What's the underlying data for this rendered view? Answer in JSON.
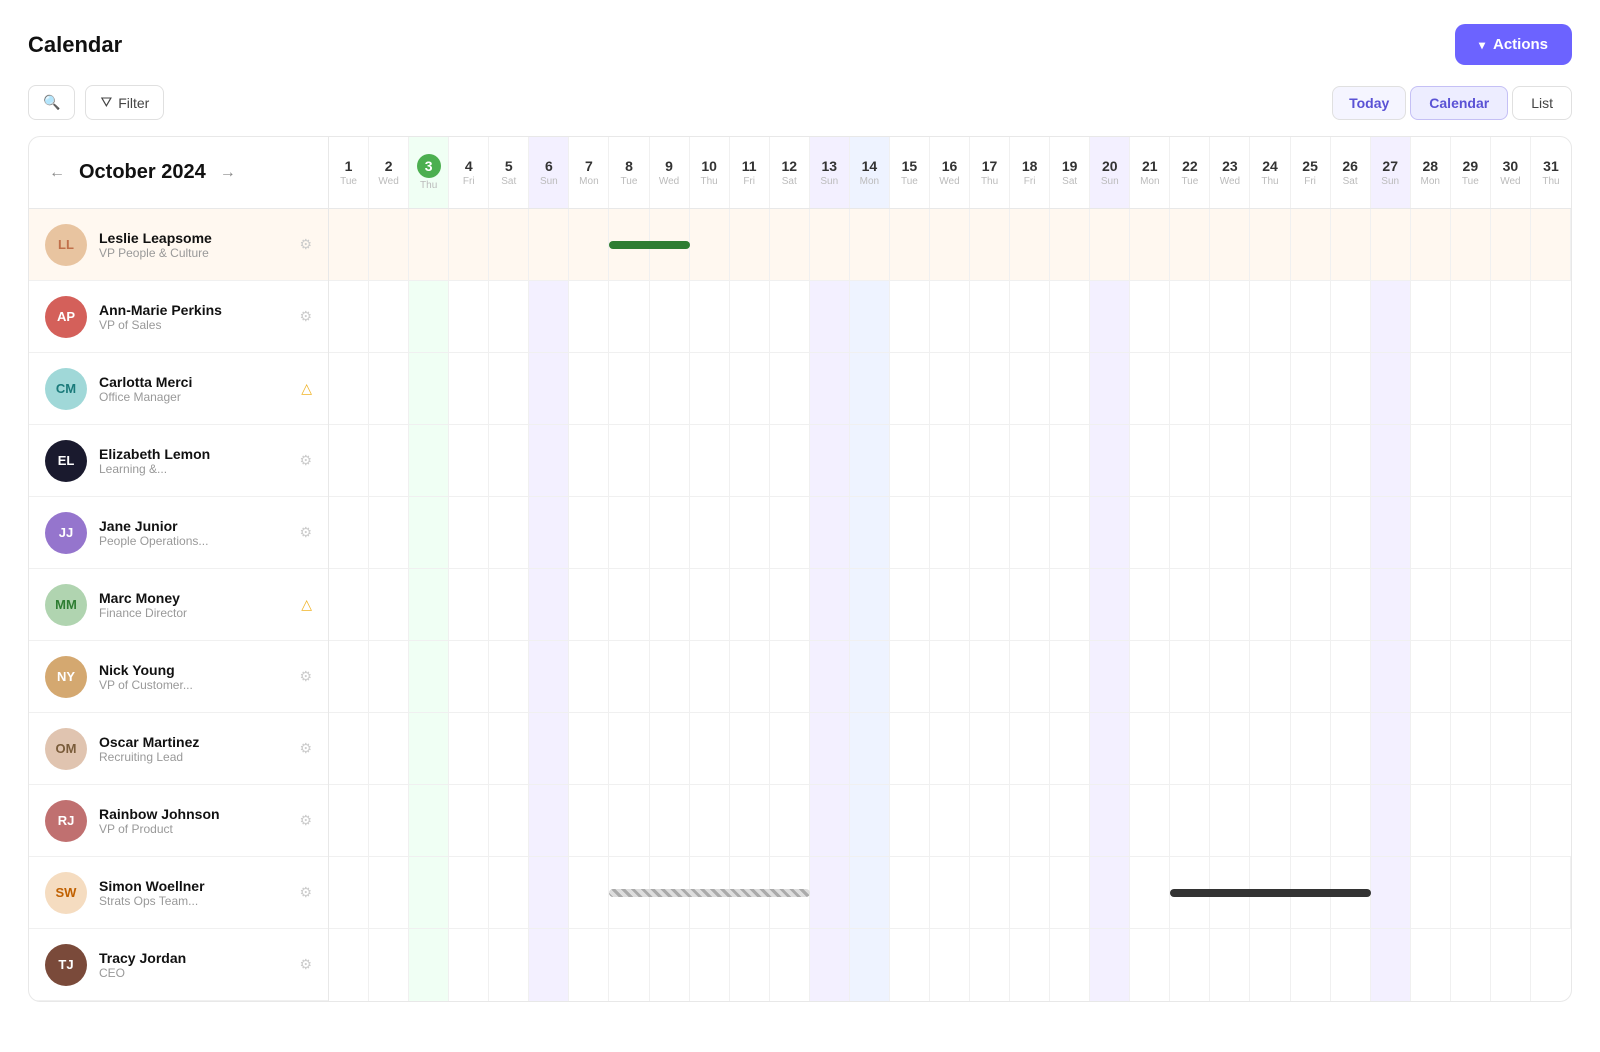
{
  "header": {
    "title": "Calendar",
    "actions_label": "Actions"
  },
  "toolbar": {
    "search_label": "Search",
    "filter_label": "Filter",
    "today_label": "Today",
    "calendar_label": "Calendar",
    "list_label": "List"
  },
  "month": {
    "label": "October 2024",
    "year": 2024,
    "month": 10
  },
  "dates": [
    {
      "day": 1,
      "dow": "Tue"
    },
    {
      "day": 2,
      "dow": "Wed"
    },
    {
      "day": 3,
      "dow": "Thu"
    },
    {
      "day": 4,
      "dow": "Fri"
    },
    {
      "day": 5,
      "dow": "Sat"
    },
    {
      "day": 6,
      "dow": "Sun"
    },
    {
      "day": 7,
      "dow": "Mon"
    },
    {
      "day": 8,
      "dow": "Tue"
    },
    {
      "day": 9,
      "dow": "Wed"
    },
    {
      "day": 10,
      "dow": "Thu"
    },
    {
      "day": 11,
      "dow": "Fri"
    },
    {
      "day": 12,
      "dow": "Sat"
    },
    {
      "day": 13,
      "dow": "Sun"
    },
    {
      "day": 14,
      "dow": "Mon"
    },
    {
      "day": 15,
      "dow": "Tue"
    },
    {
      "day": 16,
      "dow": "Wed"
    },
    {
      "day": 17,
      "dow": "Thu"
    },
    {
      "day": 18,
      "dow": "Fri"
    },
    {
      "day": 19,
      "dow": "Sat"
    },
    {
      "day": 20,
      "dow": "Sun"
    },
    {
      "day": 21,
      "dow": "Mon"
    },
    {
      "day": 22,
      "dow": "Tue"
    },
    {
      "day": 23,
      "dow": "Wed"
    },
    {
      "day": 24,
      "dow": "Thu"
    },
    {
      "day": 25,
      "dow": "Fri"
    },
    {
      "day": 26,
      "dow": "Sat"
    },
    {
      "day": 27,
      "dow": "Sun"
    },
    {
      "day": 28,
      "dow": "Mon"
    },
    {
      "day": 29,
      "dow": "Tue"
    },
    {
      "day": 30,
      "dow": "Wed"
    },
    {
      "day": 31,
      "dow": "Thu"
    }
  ],
  "today_col": 3,
  "sunday_cols": [
    6,
    13,
    20,
    27
  ],
  "monday14_col": 14,
  "people": [
    {
      "id": "leslie",
      "name": "Leslie Leapsome",
      "role": "VP People & Culture",
      "avatar_type": "img",
      "avatar_color": "#e8d5c4",
      "initials": "LL",
      "highlighted": true,
      "events": [
        {
          "start": 8,
          "end": 9,
          "type": "green"
        }
      ]
    },
    {
      "id": "annmarie",
      "name": "Ann-Marie Perkins",
      "role": "VP of Sales",
      "avatar_type": "img",
      "avatar_color": "#d4a0a0",
      "initials": "AP",
      "highlighted": false,
      "events": []
    },
    {
      "id": "carlotta",
      "name": "Carlotta Merci",
      "role": "Office Manager",
      "avatar_type": "initials",
      "avatar_color": "#b2ebf2",
      "initials": "CM",
      "initials_text_color": "#00838f",
      "highlighted": false,
      "events": [],
      "icon_type": "warning"
    },
    {
      "id": "elizabeth",
      "name": "Elizabeth Lemon",
      "role": "Learning &...",
      "avatar_type": "img",
      "avatar_color": "#333",
      "initials": "EL",
      "highlighted": false,
      "events": []
    },
    {
      "id": "jane",
      "name": "Jane Junior",
      "role": "People Operations...",
      "avatar_type": "img",
      "avatar_color": "#9575cd",
      "initials": "JJ",
      "highlighted": false,
      "events": []
    },
    {
      "id": "marc",
      "name": "Marc Money",
      "role": "Finance Director",
      "avatar_type": "initials",
      "avatar_color": "#c8e6c9",
      "initials": "MM",
      "initials_text_color": "#2e7d32",
      "highlighted": false,
      "events": [],
      "icon_type": "warning"
    },
    {
      "id": "nick",
      "name": "Nick Young",
      "role": "VP of Customer...",
      "avatar_type": "img",
      "avatar_color": "#e0c9a6",
      "initials": "NY",
      "highlighted": false,
      "events": []
    },
    {
      "id": "oscar",
      "name": "Oscar Martinez",
      "role": "Recruiting Lead",
      "avatar_type": "img",
      "avatar_color": "#ffccbc",
      "initials": "OM",
      "highlighted": false,
      "events": []
    },
    {
      "id": "rainbow",
      "name": "Rainbow Johnson",
      "role": "VP of Product",
      "avatar_type": "img",
      "avatar_color": "#d7a0a0",
      "initials": "RJ",
      "highlighted": false,
      "events": []
    },
    {
      "id": "simon",
      "name": "Simon Woellner",
      "role": "Strats Ops Team...",
      "avatar_type": "initials",
      "avatar_color": "#fff3e0",
      "initials": "SW",
      "initials_text_color": "#e65100",
      "highlighted": false,
      "events": [
        {
          "start": 8,
          "end": 12,
          "type": "striped"
        },
        {
          "start": 22,
          "end": 26,
          "type": "dark"
        }
      ]
    },
    {
      "id": "tracy",
      "name": "Tracy Jordan",
      "role": "CEO",
      "avatar_type": "img",
      "avatar_color": "#8d6e63",
      "initials": "TJ",
      "highlighted": false,
      "events": []
    }
  ]
}
